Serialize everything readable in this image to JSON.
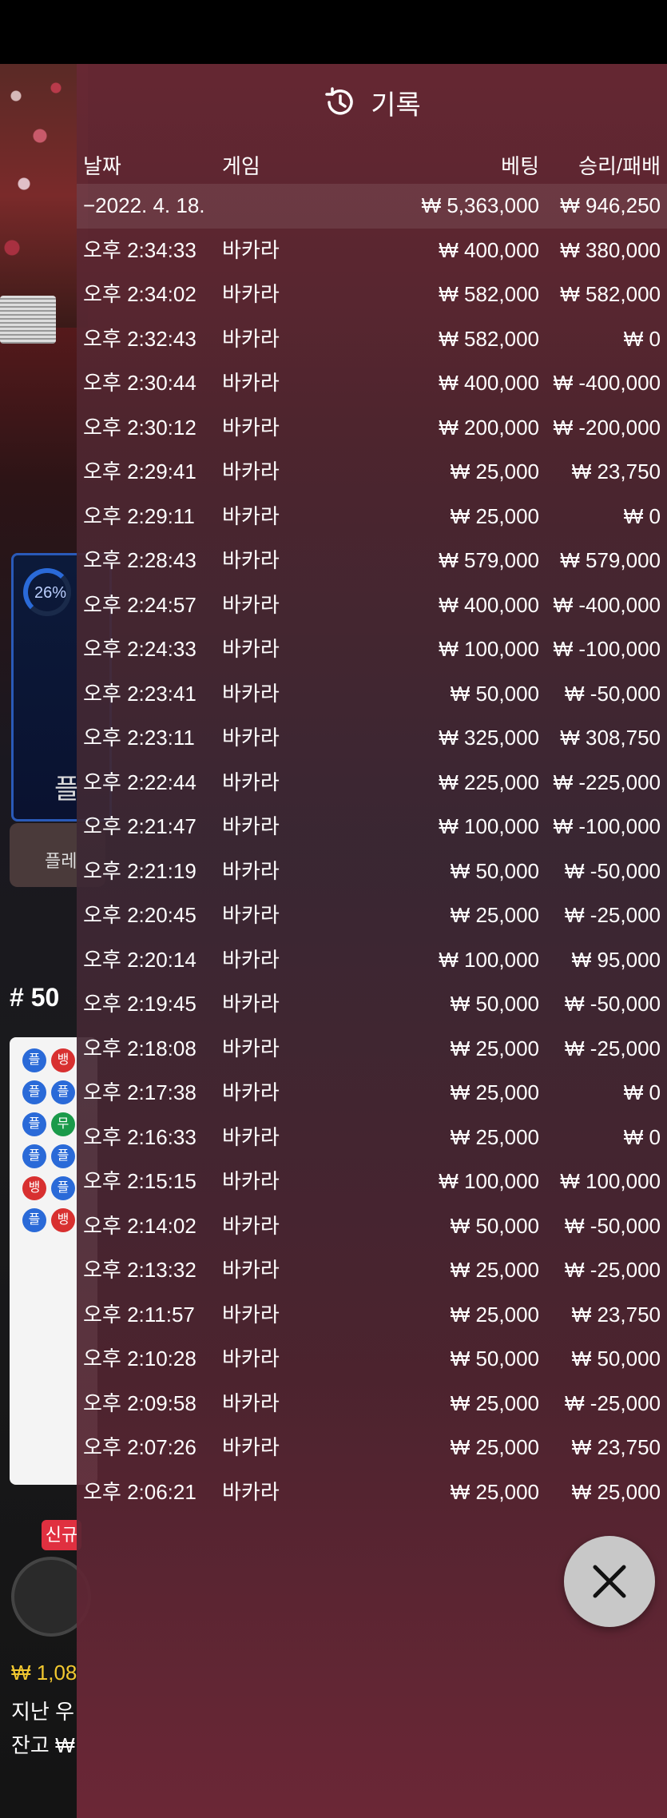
{
  "history": {
    "title": "기록",
    "columns": {
      "date": "날짜",
      "game": "게임",
      "bet": "베팅",
      "result": "승리/패배"
    },
    "date_row": {
      "date": "−2022. 4. 18.",
      "bet": "₩ 5,363,000",
      "result": "₩ 946,250"
    },
    "rows": [
      {
        "time": "오후 2:34:33",
        "game": "바카라",
        "bet": "₩ 400,000",
        "result": "₩ 380,000"
      },
      {
        "time": "오후 2:34:02",
        "game": "바카라",
        "bet": "₩ 582,000",
        "result": "₩ 582,000"
      },
      {
        "time": "오후 2:32:43",
        "game": "바카라",
        "bet": "₩ 582,000",
        "result": "₩ 0"
      },
      {
        "time": "오후 2:30:44",
        "game": "바카라",
        "bet": "₩ 400,000",
        "result": "₩ -400,000"
      },
      {
        "time": "오후 2:30:12",
        "game": "바카라",
        "bet": "₩ 200,000",
        "result": "₩ -200,000"
      },
      {
        "time": "오후 2:29:41",
        "game": "바카라",
        "bet": "₩ 25,000",
        "result": "₩ 23,750"
      },
      {
        "time": "오후 2:29:11",
        "game": "바카라",
        "bet": "₩ 25,000",
        "result": "₩ 0"
      },
      {
        "time": "오후 2:28:43",
        "game": "바카라",
        "bet": "₩ 579,000",
        "result": "₩ 579,000"
      },
      {
        "time": "오후 2:24:57",
        "game": "바카라",
        "bet": "₩ 400,000",
        "result": "₩ -400,000"
      },
      {
        "time": "오후 2:24:33",
        "game": "바카라",
        "bet": "₩ 100,000",
        "result": "₩ -100,000"
      },
      {
        "time": "오후 2:23:41",
        "game": "바카라",
        "bet": "₩ 50,000",
        "result": "₩ -50,000"
      },
      {
        "time": "오후 2:23:11",
        "game": "바카라",
        "bet": "₩ 325,000",
        "result": "₩ 308,750"
      },
      {
        "time": "오후 2:22:44",
        "game": "바카라",
        "bet": "₩ 225,000",
        "result": "₩ -225,000"
      },
      {
        "time": "오후 2:21:47",
        "game": "바카라",
        "bet": "₩ 100,000",
        "result": "₩ -100,000"
      },
      {
        "time": "오후 2:21:19",
        "game": "바카라",
        "bet": "₩ 50,000",
        "result": "₩ -50,000"
      },
      {
        "time": "오후 2:20:45",
        "game": "바카라",
        "bet": "₩ 25,000",
        "result": "₩ -25,000"
      },
      {
        "time": "오후 2:20:14",
        "game": "바카라",
        "bet": "₩ 100,000",
        "result": "₩ 95,000"
      },
      {
        "time": "오후 2:19:45",
        "game": "바카라",
        "bet": "₩ 50,000",
        "result": "₩ -50,000"
      },
      {
        "time": "오후 2:18:08",
        "game": "바카라",
        "bet": "₩ 25,000",
        "result": "₩ -25,000"
      },
      {
        "time": "오후 2:17:38",
        "game": "바카라",
        "bet": "₩ 25,000",
        "result": "₩ 0"
      },
      {
        "time": "오후 2:16:33",
        "game": "바카라",
        "bet": "₩ 25,000",
        "result": "₩ 0"
      },
      {
        "time": "오후 2:15:15",
        "game": "바카라",
        "bet": "₩ 100,000",
        "result": "₩ 100,000"
      },
      {
        "time": "오후 2:14:02",
        "game": "바카라",
        "bet": "₩ 50,000",
        "result": "₩ -50,000"
      },
      {
        "time": "오후 2:13:32",
        "game": "바카라",
        "bet": "₩ 25,000",
        "result": "₩ -25,000"
      },
      {
        "time": "오후 2:11:57",
        "game": "바카라",
        "bet": "₩ 25,000",
        "result": "₩ 23,750"
      },
      {
        "time": "오후 2:10:28",
        "game": "바카라",
        "bet": "₩ 50,000",
        "result": "₩ 50,000"
      },
      {
        "time": "오후 2:09:58",
        "game": "바카라",
        "bet": "₩ 25,000",
        "result": "₩ -25,000"
      },
      {
        "time": "오후 2:07:26",
        "game": "바카라",
        "bet": "₩ 25,000",
        "result": "₩ 23,750"
      },
      {
        "time": "오후 2:06:21",
        "game": "바카라",
        "bet": "₩ 25,000",
        "result": "₩ 25,000"
      }
    ]
  },
  "background": {
    "progress_text": "26%",
    "player_label_partial": "플",
    "player_button_partial": "플레",
    "round_label": "# 50",
    "new_badge": "신규",
    "balance_partial": "₩ 1,08",
    "last_win_label_partial": "지난 우",
    "balance_label_partial": "잔고 ₩",
    "road_markers": [
      {
        "label": "플",
        "color": "#2a6ad8"
      },
      {
        "label": "뱅",
        "color": "#d83030"
      },
      {
        "label": "플",
        "color": "#2a6ad8"
      },
      {
        "label": "플",
        "color": "#2a6ad8"
      },
      {
        "label": "플",
        "color": "#2a6ad8"
      },
      {
        "label": "무",
        "color": "#1a9a4a"
      },
      {
        "label": "플",
        "color": "#2a6ad8"
      },
      {
        "label": "플",
        "color": "#2a6ad8"
      },
      {
        "label": "뱅",
        "color": "#d83030"
      },
      {
        "label": "플",
        "color": "#2a6ad8"
      },
      {
        "label": "플",
        "color": "#2a6ad8"
      },
      {
        "label": "뱅",
        "color": "#d83030"
      }
    ]
  },
  "icons": {
    "header": "history-clock-icon",
    "close": "close-icon"
  }
}
